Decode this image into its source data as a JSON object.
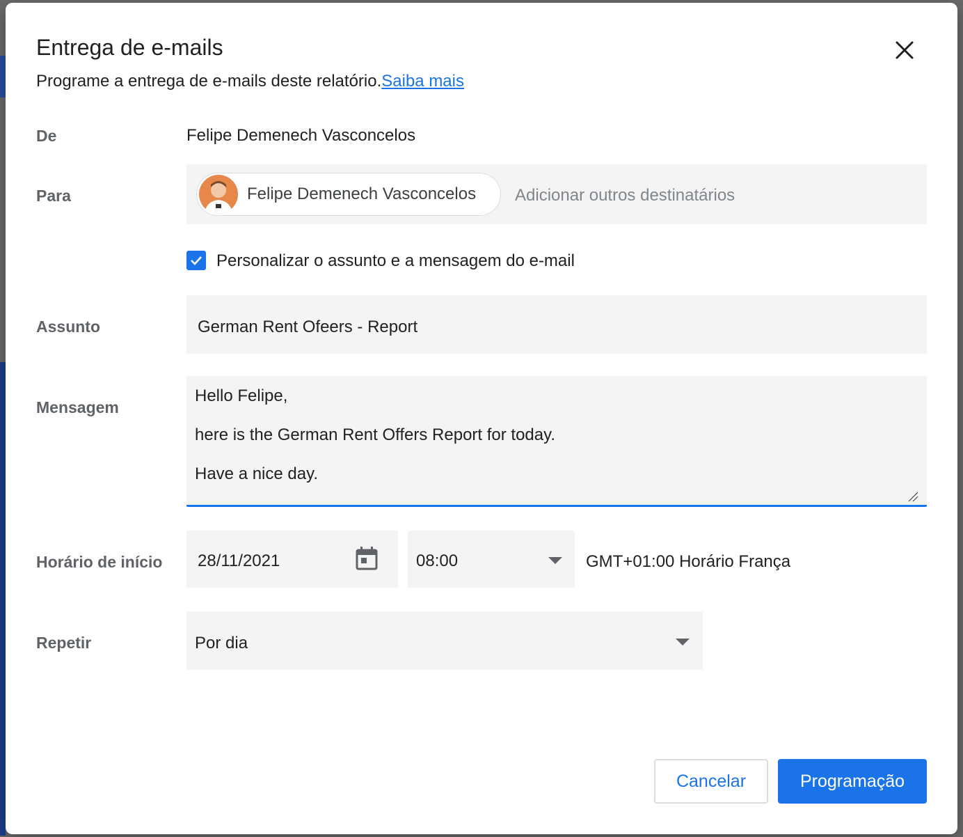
{
  "dialog": {
    "title": "Entrega de e-mails",
    "subtitle": "Programe a entrega de e-mails deste relatório.",
    "learn_more": "Saiba mais",
    "close_icon": "close-icon"
  },
  "from": {
    "label": "De",
    "value": "Felipe Demenech Vasconcelos"
  },
  "to": {
    "label": "Para",
    "chip_name": "Felipe Demenech Vasconcelos",
    "placeholder": "Adicionar outros destinatários"
  },
  "customize": {
    "label": "Personalizar o assunto e a mensagem do e-mail",
    "checked": true
  },
  "subject": {
    "label": "Assunto",
    "value": "German Rent Ofeers - Report"
  },
  "message": {
    "label": "Mensagem",
    "lines": [
      "Hello Felipe,",
      "here is the German Rent Offers Report for today.",
      "Have a nice day."
    ]
  },
  "start": {
    "label": "Horário de início",
    "date": "28/11/2021",
    "time": "08:00",
    "timezone": "GMT+01:00 Horário França"
  },
  "repeat": {
    "label": "Repetir",
    "value": "Por dia"
  },
  "buttons": {
    "cancel": "Cancelar",
    "schedule": "Programação"
  },
  "colors": {
    "accent": "#1a73e8",
    "field_bg": "#f4f4f4",
    "label": "#5f6368"
  }
}
